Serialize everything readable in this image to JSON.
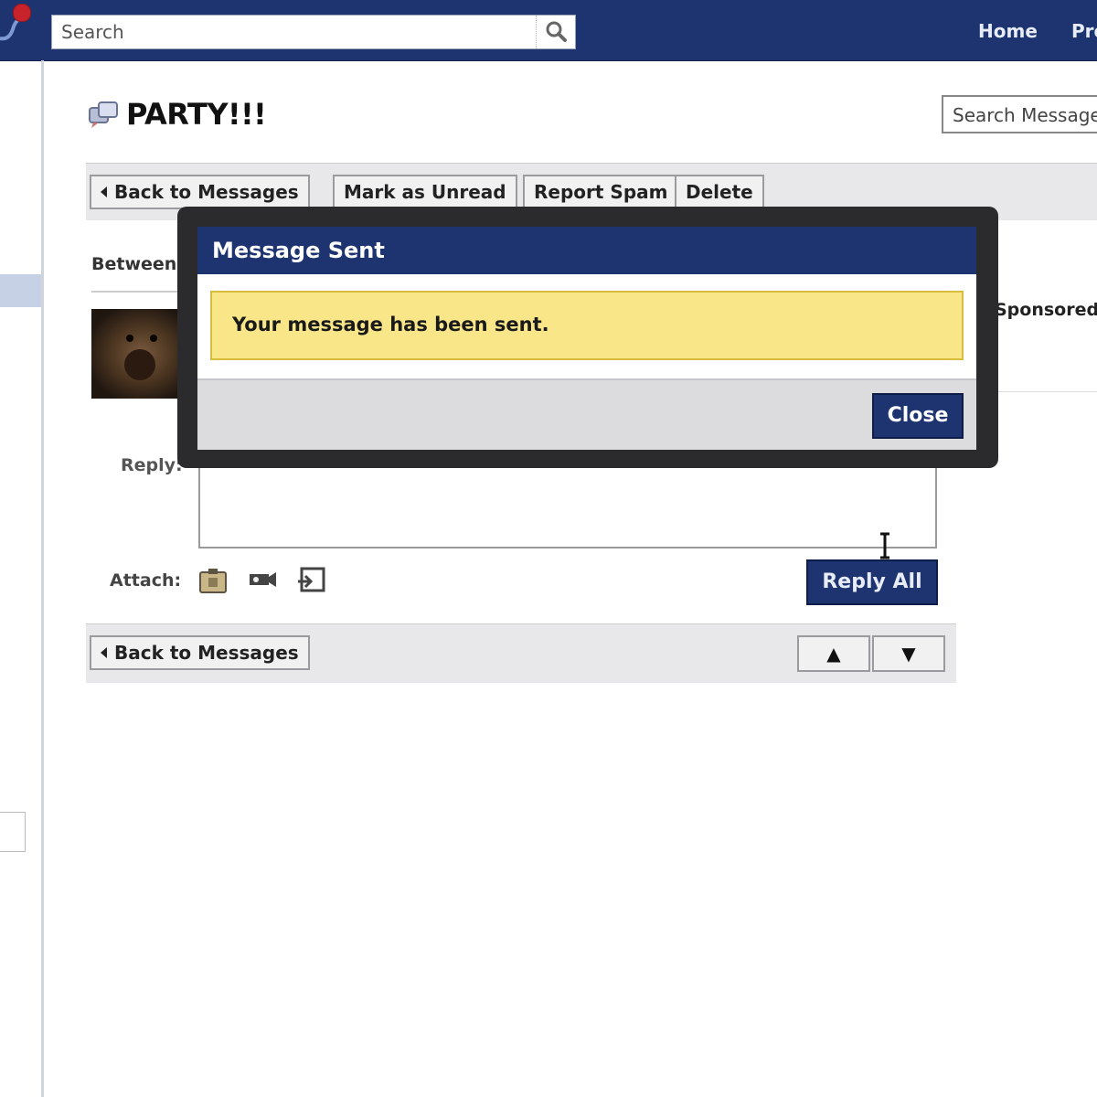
{
  "topbar": {
    "search_placeholder": "Search",
    "nav": [
      "Home",
      "Pro"
    ],
    "colors": {
      "bar": "#1d3470",
      "badge": "#c8232b"
    }
  },
  "title": {
    "text": "PARTY!!!",
    "search_messages_placeholder": "Search Messages"
  },
  "toolbar_top": {
    "back": "Back to Messages",
    "mark_unread": "Mark as Unread",
    "report_spam": "Report Spam",
    "delete": "Delete"
  },
  "thread": {
    "between_label": "Between",
    "sponsored_label": "Sponsored",
    "reply_label": "Reply:",
    "attach_label": "Attach:",
    "attach_icons": [
      "photo-icon",
      "video-icon",
      "share-link-icon"
    ],
    "reply_all": "Reply All"
  },
  "toolbar_bottom": {
    "back": "Back to Messages",
    "prev": "▲",
    "next": "▼"
  },
  "modal": {
    "title": "Message Sent",
    "message": "Your message has been sent.",
    "close": "Close",
    "colors": {
      "header": "#1d3470",
      "notice_bg": "#f8e689",
      "notice_border": "#d7bc3e"
    }
  }
}
